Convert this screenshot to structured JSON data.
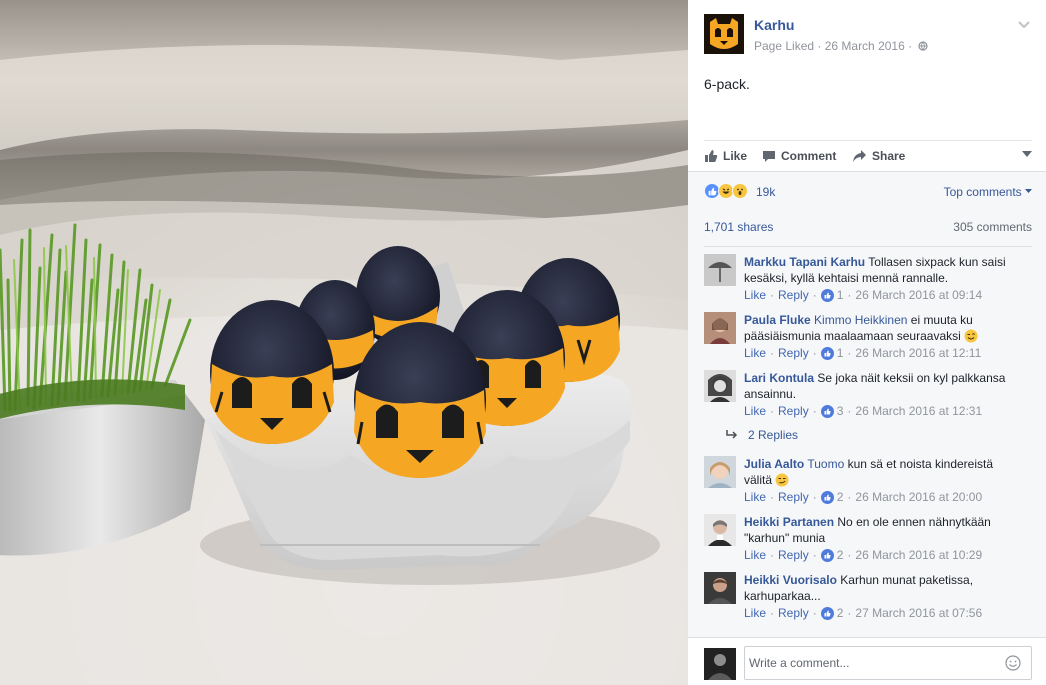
{
  "post": {
    "page_name": "Karhu",
    "meta": "Page Liked · 26 March 2016 ·",
    "text": "6-pack."
  },
  "actions": {
    "like": "Like",
    "comment": "Comment",
    "share": "Share"
  },
  "reactions": {
    "count": "19k",
    "icons": [
      "like-reaction-icon",
      "haha-reaction-icon",
      "wow-reaction-icon"
    ],
    "filter": "Top comments"
  },
  "stats": {
    "shares": "1,701 shares",
    "comments": "305 comments"
  },
  "comment_actions": {
    "like": "Like",
    "reply": "Reply",
    "sep": "·"
  },
  "comments": [
    {
      "author": "Markku Tapani Karhu",
      "tag": "",
      "text": "Tollasen sixpack kun saisi kesäksi, kyllä kehtaisi mennä rannalle.",
      "likes": "1",
      "time": "26 March 2016 at 09:14"
    },
    {
      "author": "Paula Fluke",
      "tag": "Kimmo Heikkinen",
      "text": "ei muuta ku pääsiäismunia maalaamaan seuraavaksi",
      "likes": "1",
      "time": "26 March 2016 at 12:11"
    },
    {
      "author": "Lari Kontula",
      "tag": "",
      "text": "Se joka näit keksii on kyl palkkansa ansainnu.",
      "likes": "3",
      "time": "26 March 2016 at 12:31"
    },
    {
      "author": "Julia Aalto",
      "tag": "Tuomo",
      "text": "kun sä et noista kindereistä välitä",
      "likes": "2",
      "time": "26 March 2016 at 20:00"
    },
    {
      "author": "Heikki Partanen",
      "tag": "",
      "text": "No en ole ennen nähnytkään \"karhun\" munia",
      "likes": "2",
      "time": "26 March 2016 at 10:29"
    },
    {
      "author": "Heikki Vuorisalo",
      "tag": "",
      "text": "Karhun munat paketissa, karhuparkaa...",
      "likes": "2",
      "time": "27 March 2016 at 07:56"
    }
  ],
  "replies": {
    "label": "2 Replies"
  },
  "composer": {
    "placeholder": "Write a comment..."
  },
  "colors": {
    "link": "#365899",
    "accent": "#4267b2",
    "egg_orange": "#f5a623"
  }
}
